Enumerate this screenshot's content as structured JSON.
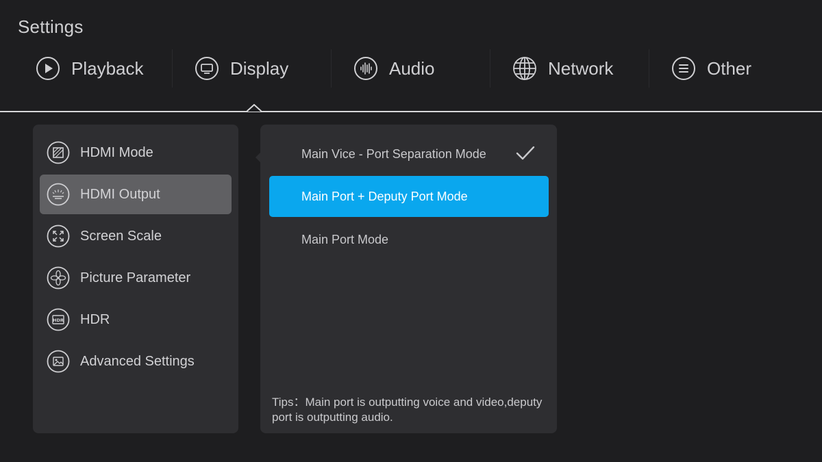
{
  "header": {
    "title": "Settings"
  },
  "tabs": [
    {
      "label": "Playback",
      "icon": "play-icon"
    },
    {
      "label": "Display",
      "icon": "monitor-icon",
      "selected": true
    },
    {
      "label": "Audio",
      "icon": "sound-wave-icon"
    },
    {
      "label": "Network",
      "icon": "globe-icon"
    },
    {
      "label": "Other",
      "icon": "menu-lines-icon"
    }
  ],
  "menu": {
    "items": [
      {
        "label": "HDMI Mode",
        "icon": "hdmi-mode-icon"
      },
      {
        "label": "HDMI Output",
        "icon": "hdmi-output-icon",
        "active": true
      },
      {
        "label": "Screen Scale",
        "icon": "screen-scale-icon"
      },
      {
        "label": "Picture Parameter",
        "icon": "picture-parameter-icon"
      },
      {
        "label": "HDR",
        "icon": "hdr-icon"
      },
      {
        "label": "Advanced Settings",
        "icon": "advanced-settings-icon"
      }
    ]
  },
  "options": {
    "items": [
      {
        "label": "Main Vice - Port Separation Mode",
        "checked": true
      },
      {
        "label": "Main Port + Deputy Port Mode",
        "highlighted": true
      },
      {
        "label": "Main Port Mode"
      }
    ],
    "tips": "Tips：Main port is outputting voice and video,deputy port is outputting audio."
  },
  "colors": {
    "background": "#1e1e20",
    "panel": "#2e2e31",
    "active_menu": "#606063",
    "highlight": "#0aa7ee"
  }
}
